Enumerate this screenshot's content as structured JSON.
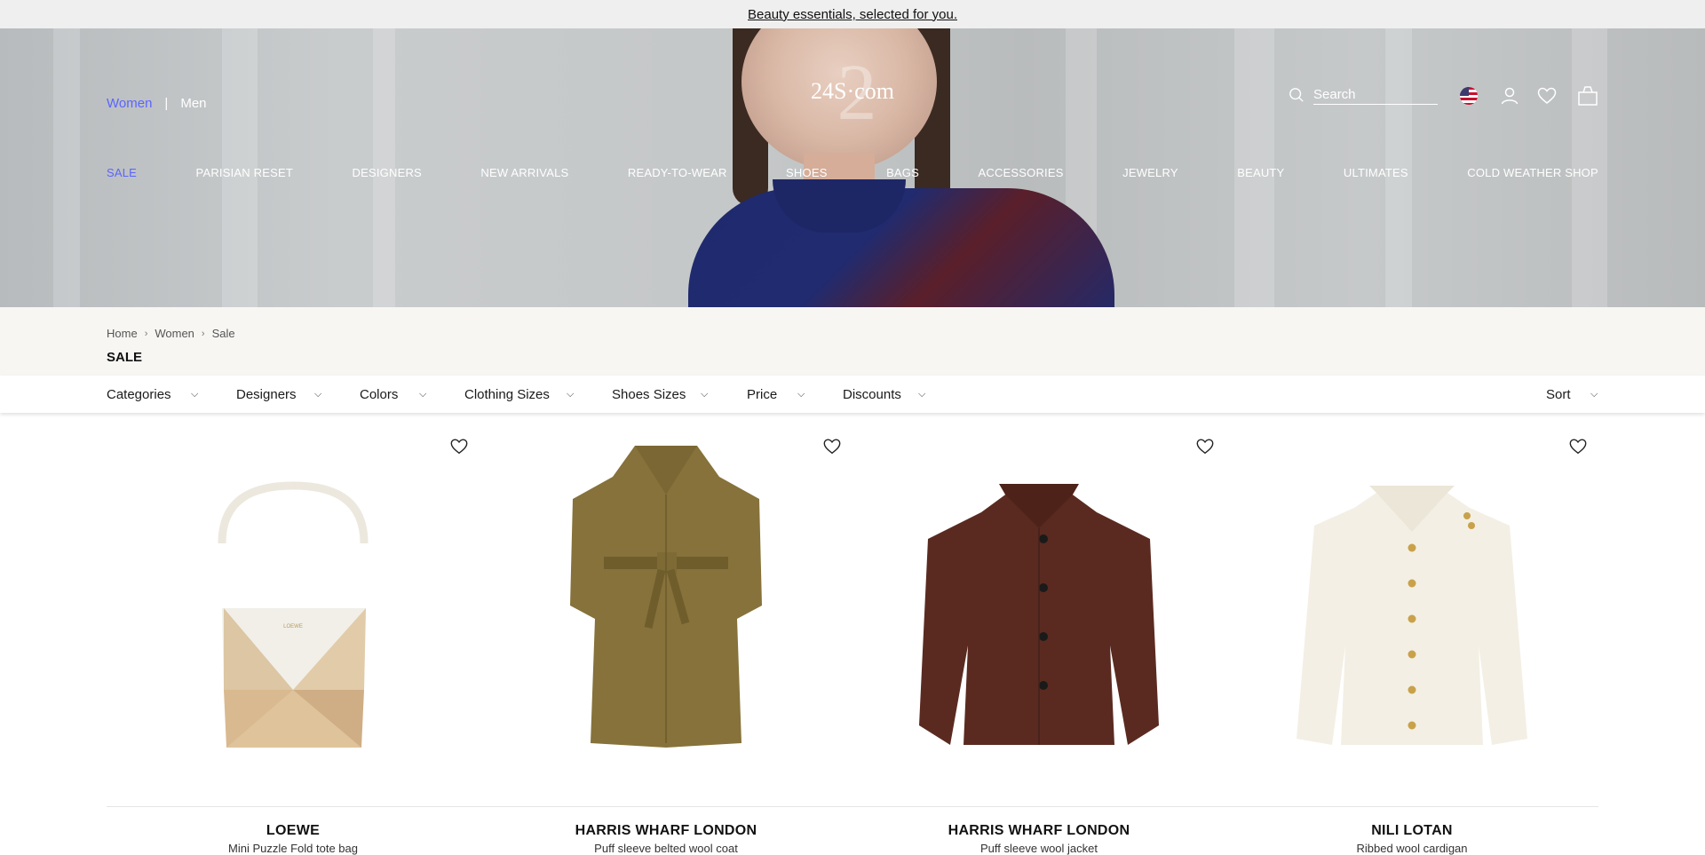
{
  "promo": {
    "text": "Beauty essentials, selected for you."
  },
  "header": {
    "gender_women": "Women",
    "gender_sep": "|",
    "gender_men": "Men",
    "logo": "24S·com",
    "search_placeholder": "Search"
  },
  "nav": {
    "items": [
      "SALE",
      "PARISIAN RESET",
      "DESIGNERS",
      "NEW ARRIVALS",
      "READY-TO-WEAR",
      "SHOES",
      "BAGS",
      "ACCESSORIES",
      "JEWELRY",
      "BEAUTY",
      "ULTIMATES",
      "COLD WEATHER SHOP"
    ]
  },
  "breadcrumb": {
    "items": [
      "Home",
      "Women",
      "Sale"
    ]
  },
  "page": {
    "title": "SALE"
  },
  "filters": {
    "items": [
      "Categories",
      "Designers",
      "Colors",
      "Clothing Sizes",
      "Shoes Sizes",
      "Price",
      "Discounts"
    ],
    "sort": "Sort"
  },
  "products": [
    {
      "brand": "LOEWE",
      "name": "Mini Puzzle Fold tote bag"
    },
    {
      "brand": "HARRIS WHARF LONDON",
      "name": "Puff sleeve belted wool coat"
    },
    {
      "brand": "HARRIS WHARF LONDON",
      "name": "Puff sleeve wool jacket"
    },
    {
      "brand": "NILI LOTAN",
      "name": "Ribbed wool cardigan"
    }
  ],
  "colors": {
    "accent": "#5b64ff",
    "promo_bg": "#efefef",
    "crumb_bg": "#f7f6f3"
  },
  "icons": [
    "search-icon",
    "flag-us-icon",
    "account-icon",
    "heart-icon",
    "bag-icon",
    "chevron-right-icon",
    "chevron-down-icon"
  ]
}
